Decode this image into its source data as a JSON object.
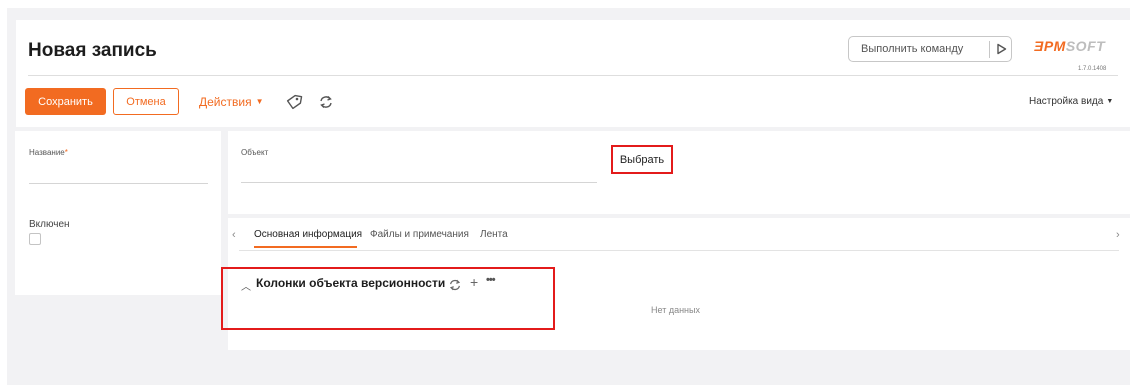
{
  "header": {
    "title": "Новая запись",
    "command_placeholder": "Выполнить команду",
    "logo_part1": "ƎPM",
    "logo_part2": "SOFT",
    "version": "1.7.0.1408"
  },
  "toolbar": {
    "save_label": "Сохранить",
    "cancel_label": "Отмена",
    "actions_label": "Действия",
    "view_settings_label": "Настройка вида"
  },
  "left_panel": {
    "name_label": "Название",
    "required_mark": "*",
    "enabled_label": "Включен"
  },
  "object_panel": {
    "object_label": "Объект",
    "choose_label": "Выбрать"
  },
  "tabs": [
    {
      "label": "Основная информация",
      "active": true
    },
    {
      "label": "Файлы и примечания",
      "active": false
    },
    {
      "label": "Лента",
      "active": false
    }
  ],
  "detail": {
    "title": "Колонки объекта версионности",
    "empty_text": "Нет данных"
  },
  "colors": {
    "accent": "#f26b21",
    "highlight": "#e31b1b"
  },
  "icons": [
    "tag-icon",
    "sync-icon",
    "play-icon",
    "chevron-left-icon",
    "chevron-right-icon",
    "collapse-icon",
    "add-icon",
    "more-icon"
  ]
}
